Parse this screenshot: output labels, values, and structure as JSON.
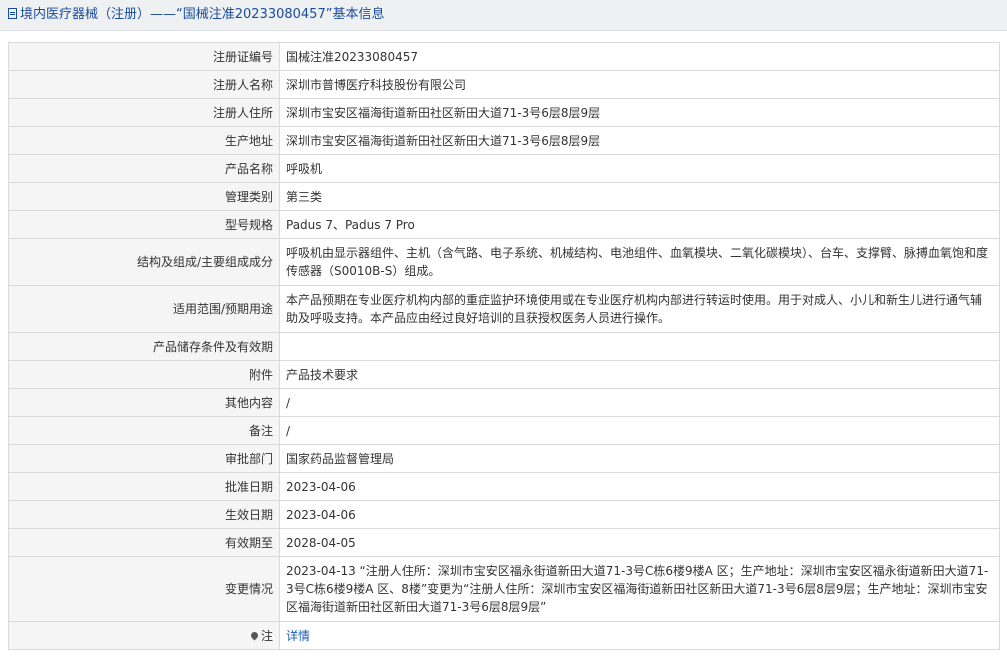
{
  "header": {
    "title": "境内医疗器械（注册）——“国械注准20233080457”基本信息"
  },
  "rows": [
    {
      "label": "注册证编号",
      "value": "国械注准20233080457"
    },
    {
      "label": "注册人名称",
      "value": "深圳市普博医疗科技股份有限公司"
    },
    {
      "label": "注册人住所",
      "value": "深圳市宝安区福海街道新田社区新田大道71-3号6层8层9层"
    },
    {
      "label": "生产地址",
      "value": "深圳市宝安区福海街道新田社区新田大道71-3号6层8层9层"
    },
    {
      "label": "产品名称",
      "value": "呼吸机"
    },
    {
      "label": "管理类别",
      "value": "第三类"
    },
    {
      "label": "型号规格",
      "value": "Padus 7、Padus 7 Pro"
    },
    {
      "label": "结构及组成/主要组成成分",
      "value": "呼吸机由显示器组件、主机（含气路、电子系统、机械结构、电池组件、血氧模块、二氧化碳模块）、台车、支撑臂、脉搏血氧饱和度传感器（S0010B-S）组成。"
    },
    {
      "label": "适用范围/预期用途",
      "value": "本产品预期在专业医疗机构内部的重症监护环境使用或在专业医疗机构内部进行转运时使用。用于对成人、小儿和新生儿进行通气辅助及呼吸支持。本产品应由经过良好培训的且获授权医务人员进行操作。"
    },
    {
      "label": "产品储存条件及有效期",
      "value": ""
    },
    {
      "label": "附件",
      "value": "产品技术要求"
    },
    {
      "label": "其他内容",
      "value": "/"
    },
    {
      "label": "备注",
      "value": "/"
    },
    {
      "label": "审批部门",
      "value": "国家药品监督管理局"
    },
    {
      "label": "批准日期",
      "value": "2023-04-06"
    },
    {
      "label": "生效日期",
      "value": "2023-04-06"
    },
    {
      "label": "有效期至",
      "value": "2028-04-05"
    },
    {
      "label": "变更情况",
      "value": "2023-04-13 “注册人住所：深圳市宝安区福永街道新田大道71-3号C栋6楼9楼A 区；生产地址：深圳市宝安区福永街道新田大道71-3号C栋6楼9楼A 区、8楼”变更为“注册人住所：深圳市宝安区福海街道新田社区新田大道71-3号6层8层9层；生产地址：深圳市宝安区福海街道新田社区新田大道71-3号6层8层9层”"
    }
  ],
  "footer_row": {
    "label": "注",
    "link_text": "详情",
    "icon": "pin-icon"
  }
}
